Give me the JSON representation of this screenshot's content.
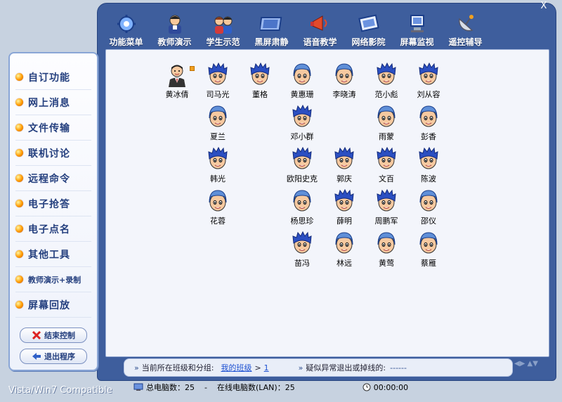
{
  "toolbar": {
    "items": [
      {
        "label": "功能菜单",
        "icon": "gear-icon"
      },
      {
        "label": "教师演示",
        "icon": "teacher-icon"
      },
      {
        "label": "学生示范",
        "icon": "students-icon"
      },
      {
        "label": "黑屏肃静",
        "icon": "black-screen-icon"
      },
      {
        "label": "语音教学",
        "icon": "megaphone-icon"
      },
      {
        "label": "网络影院",
        "icon": "video-icon"
      },
      {
        "label": "屏幕监视",
        "icon": "monitor-icon"
      },
      {
        "label": "遥控辅导",
        "icon": "satellite-icon"
      }
    ],
    "close_label": "X"
  },
  "sidebar": {
    "items": [
      {
        "label": "自订功能"
      },
      {
        "label": "网上消息"
      },
      {
        "label": "文件传输"
      },
      {
        "label": "联机讨论"
      },
      {
        "label": "远程命令"
      },
      {
        "label": "电子抢答"
      },
      {
        "label": "电子点名"
      },
      {
        "label": "其他工具"
      },
      {
        "label": "教师演示+录制"
      },
      {
        "label": "屏幕回放"
      }
    ],
    "buttons": [
      {
        "label": "结束控制",
        "icon": "stop-icon"
      },
      {
        "label": "退出程序",
        "icon": "exit-icon"
      }
    ]
  },
  "students": [
    {
      "name": "黄冰倩",
      "type": "teacher"
    },
    {
      "name": "司马光",
      "type": "boy"
    },
    {
      "name": "董格",
      "type": "boy"
    },
    {
      "name": "黄惠珊",
      "type": "girl"
    },
    {
      "name": "李晓涛",
      "type": "girl"
    },
    {
      "name": "范小彪",
      "type": "boy"
    },
    {
      "name": "刘从容",
      "type": "boy"
    },
    {
      "name": "夏兰",
      "type": "girl"
    },
    {
      "name": "邓小群",
      "type": "boy"
    },
    {
      "name": "雨蒙",
      "type": "girl"
    },
    {
      "name": "彭香",
      "type": "girl"
    },
    {
      "name": "韩光",
      "type": "boy"
    },
    {
      "name": "欧阳史克",
      "type": "boy"
    },
    {
      "name": "郭庆",
      "type": "boy"
    },
    {
      "name": "文百",
      "type": "boy"
    },
    {
      "name": "陈波",
      "type": "boy"
    },
    {
      "name": "花蓉",
      "type": "girl"
    },
    {
      "name": "杨思珍",
      "type": "girl"
    },
    {
      "name": "薛明",
      "type": "boy"
    },
    {
      "name": "周鹏军",
      "type": "boy"
    },
    {
      "name": "邵仪",
      "type": "girl"
    },
    {
      "name": "苗冯",
      "type": "boy"
    },
    {
      "name": "林远",
      "type": "girl"
    },
    {
      "name": "黄莺",
      "type": "girl"
    },
    {
      "name": "蔡雁",
      "type": "girl"
    }
  ],
  "status": {
    "class_label": "当前所在班级和分组:",
    "class_link": "我的班级",
    "group_link": "1",
    "separator": ">",
    "abnormal_label": "疑似异常退出或掉线的:",
    "abnormal_value": "------"
  },
  "bottom": {
    "total_label": "总电脑数：",
    "total_value": "25",
    "dash": "-",
    "online_label": "在线电脑数(LAN)：",
    "online_value": "25",
    "timer": "00:00:00"
  },
  "footer": {
    "compat": "Vista/Win7 Compatible"
  },
  "colors": {
    "frame": "#3e5e9d",
    "accent": "#243f7e",
    "link": "#1b4fd1"
  }
}
